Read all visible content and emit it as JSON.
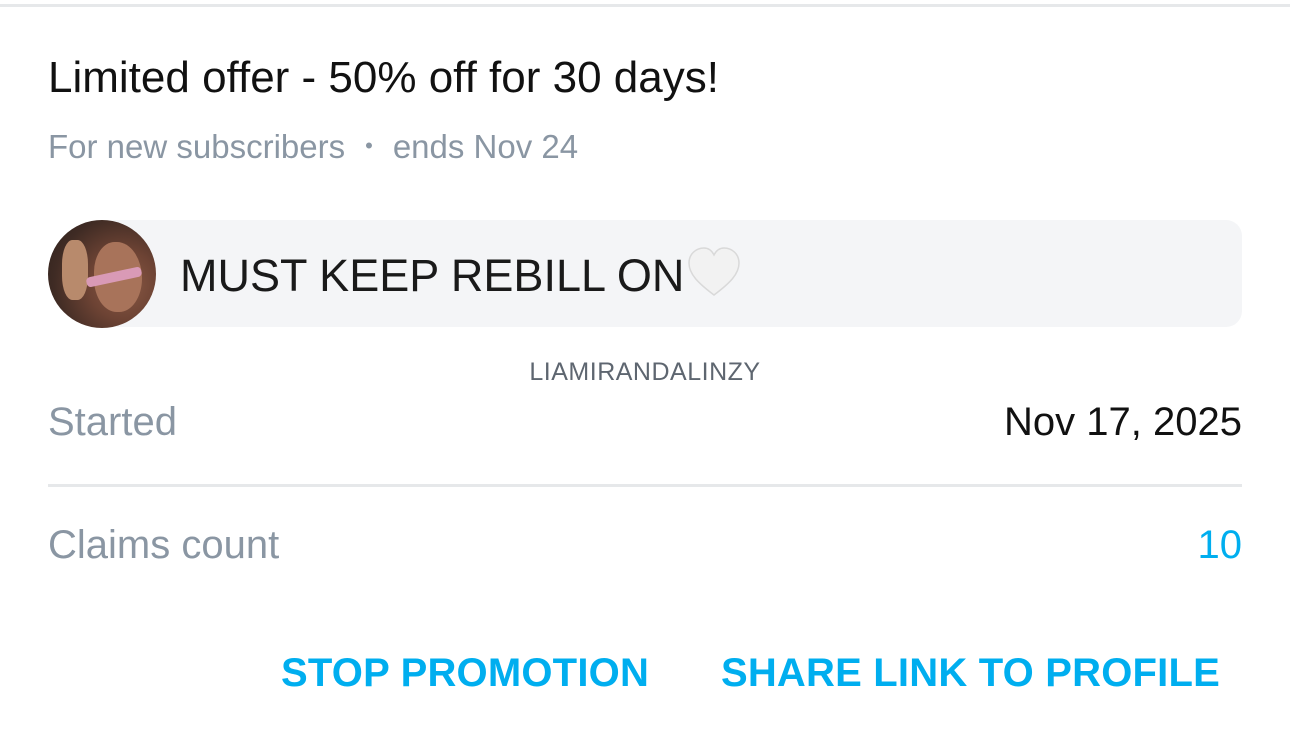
{
  "offer": {
    "title": "Limited offer - 50% off for 30 days!",
    "audience": "For new subscribers",
    "separator": "•",
    "ends": "ends Nov 24"
  },
  "message": {
    "text": "MUST KEEP REBILL ON",
    "emoji_icon": "white-heart-icon"
  },
  "creator": {
    "username": "LIAMIRANDALINZY"
  },
  "details": {
    "started_label": "Started",
    "started_value": "Nov 17, 2025",
    "claims_label": "Claims count",
    "claims_value": "10"
  },
  "actions": {
    "stop_label": "STOP PROMOTION",
    "share_label": "SHARE LINK TO PROFILE"
  },
  "colors": {
    "accent": "#00aeef",
    "muted_text": "#8a96a3",
    "primary_text": "#111111",
    "divider": "#e6e8ea",
    "bubble_bg": "#f4f5f7"
  }
}
